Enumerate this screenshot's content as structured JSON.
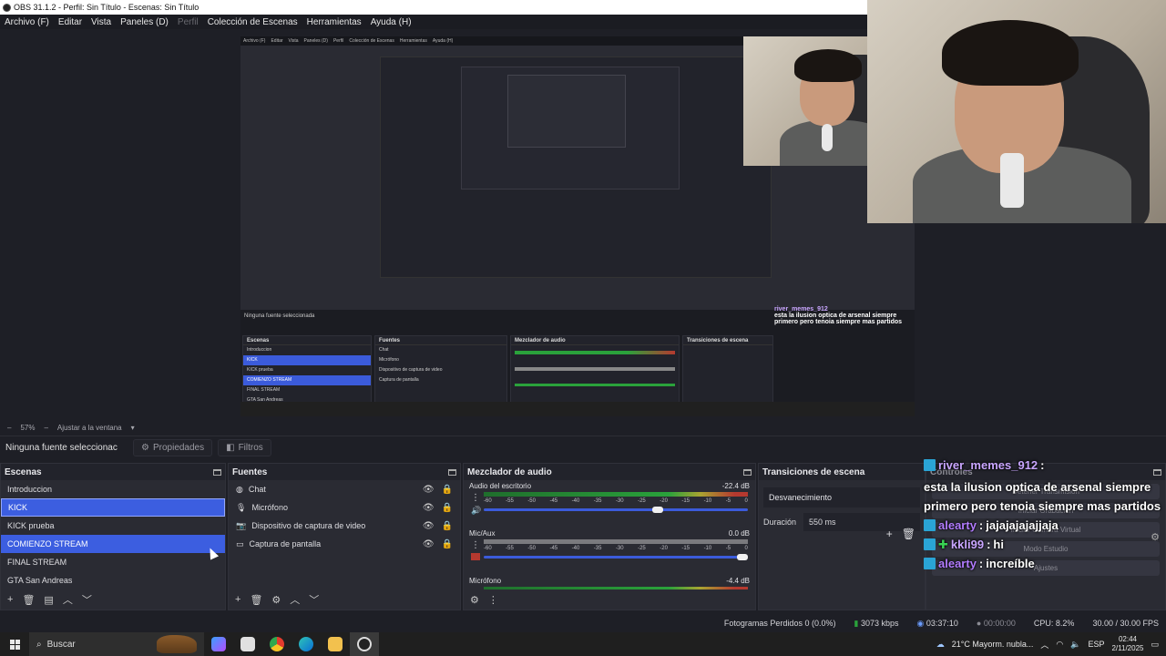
{
  "window": {
    "title": "OBS 31.1.2 - Perfil: Sin Título - Escenas: Sin Título"
  },
  "menu": [
    "Archivo (F)",
    "Editar",
    "Vista",
    "Paneles (D)",
    "Perfil",
    "Colección de Escenas",
    "Herramientas",
    "Ayuda (H)"
  ],
  "preview": {
    "nested_menu": [
      "Archivo (F)",
      "Editar",
      "Vista",
      "Paneles (D)",
      "Perfil",
      "Colección de Escenas",
      "Herramientas",
      "Ayuda (H)"
    ],
    "nested_title": "OBS 31.1.2 - Perfil: Sin Título - Escenas: Sin Título",
    "nested_scenes": [
      "Introduccion",
      "KICK",
      "KICK prueba",
      "COMIENZO STREAM",
      "FINAL STREAM",
      "GTA San Andreas"
    ],
    "nested_sources": [
      "Chat",
      "Micrófono",
      "Dispositivo de captura de video",
      "Captura de pantalla"
    ],
    "nested_props": "Ninguna fuente seleccionada",
    "nested_docks": [
      "Escenas",
      "Fuentes",
      "Mezclador de audio",
      "Transiciones de escena"
    ]
  },
  "zoom": {
    "value": "57%",
    "fit_label": "Ajustar a la ventana"
  },
  "props_bar": {
    "no_source": "Ninguna fuente seleccionac",
    "properties": "Propiedades",
    "filters": "Filtros"
  },
  "scenes": {
    "title": "Escenas",
    "items": [
      {
        "label": "Introduccion",
        "selected": false
      },
      {
        "label": "KICK",
        "selected": true
      },
      {
        "label": "KICK prueba",
        "selected": false
      },
      {
        "label": "COMIENZO STREAM",
        "selected": true
      },
      {
        "label": "FINAL STREAM",
        "selected": false
      },
      {
        "label": "GTA San Andreas",
        "selected": false
      }
    ]
  },
  "sources": {
    "title": "Fuentes",
    "items": [
      {
        "label": "Chat",
        "icon": "browser-icon"
      },
      {
        "label": "Micrófono",
        "icon": "microphone-icon"
      },
      {
        "label": "Dispositivo de captura de video",
        "icon": "camera-icon"
      },
      {
        "label": "Captura de pantalla",
        "icon": "monitor-icon"
      }
    ]
  },
  "mixer": {
    "title": "Mezclador de audio",
    "ticks": [
      "-60",
      "-55",
      "-50",
      "-45",
      "-40",
      "-35",
      "-30",
      "-25",
      "-20",
      "-15",
      "-10",
      "-5",
      "0"
    ],
    "channels": [
      {
        "name": "Audio del escritorio",
        "db": "-22.4 dB",
        "level": 0.66
      },
      {
        "name": "Mic/Aux",
        "db": "0.0 dB",
        "level": 0.98
      },
      {
        "name": "Micrófono",
        "db": "-4.4 dB"
      }
    ]
  },
  "transitions": {
    "title": "Transiciones de escena",
    "type": "Desvanecimiento",
    "duration_label": "Duración",
    "duration_value": "550 ms"
  },
  "controls": {
    "title": "Controles",
    "buttons": [
      "Detener Transmisión",
      "Iniciar Grabación",
      "Iniciar Cámara Virtual",
      "Modo Estudio",
      "Ajustes"
    ]
  },
  "chat": [
    {
      "user": "river_memes_912",
      "text": "esta la ilusion optica de arsenal siempre primero pero tenoia siempre mas partidos",
      "color": "#c9a6ff"
    },
    {
      "user": "alearty",
      "text": "jajajajajajjaja",
      "color": "#b27cff"
    },
    {
      "user": "kkli99",
      "text": "hi",
      "color": "#c9a6ff"
    },
    {
      "user": "alearty",
      "text": "increíble",
      "color": "#b27cff"
    }
  ],
  "status": {
    "frames_dropped": "Fotogramas Perdidos 0 (0.0%)",
    "bitrate": "3073 kbps",
    "stream_time": "03:37:10",
    "rec_time": "00:00:00",
    "cpu": "CPU: 8.2%",
    "fps": "30.00 / 30.00 FPS"
  },
  "taskbar": {
    "search": "Buscar",
    "weather": "21°C  Mayorm. nubla...",
    "lang": "ESP",
    "time": "02:44",
    "date": "2/11/2025"
  }
}
